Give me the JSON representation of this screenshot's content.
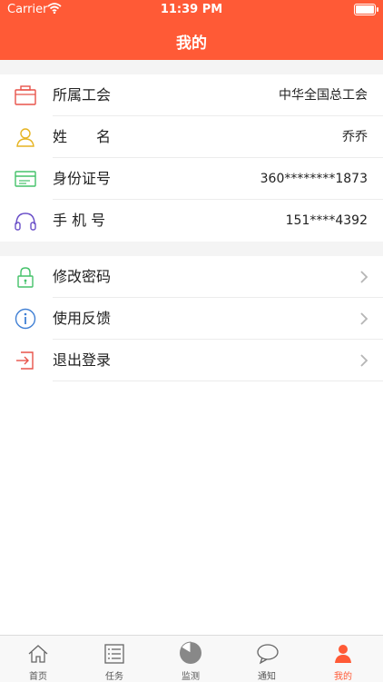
{
  "status_bar": {
    "carrier": "Carrier",
    "time": "11:39 PM"
  },
  "header": {
    "title": "我的"
  },
  "profile": [
    {
      "label": "所属工会",
      "value": "中华全国总工会",
      "icon": "briefcase-icon"
    },
    {
      "label": "姓　　名",
      "value": "乔乔",
      "icon": "person-icon"
    },
    {
      "label": "身份证号",
      "value": "360********1873",
      "icon": "id-card-icon"
    },
    {
      "label": "手 机 号",
      "value": "151****4392",
      "icon": "headset-icon"
    }
  ],
  "actions": [
    {
      "label": "修改密码",
      "icon": "lock-icon"
    },
    {
      "label": "使用反馈",
      "icon": "info-icon"
    },
    {
      "label": "退出登录",
      "icon": "logout-icon"
    }
  ],
  "tabs": [
    {
      "label": "首页",
      "icon": "home-icon"
    },
    {
      "label": "任务",
      "icon": "list-icon"
    },
    {
      "label": "监测",
      "icon": "pie-chart-icon"
    },
    {
      "label": "通知",
      "icon": "chat-bubble-icon"
    },
    {
      "label": "我的",
      "icon": "user-icon",
      "active": true
    }
  ],
  "colors": {
    "accent": "#ff5a36",
    "tab_inactive": "#555555"
  }
}
